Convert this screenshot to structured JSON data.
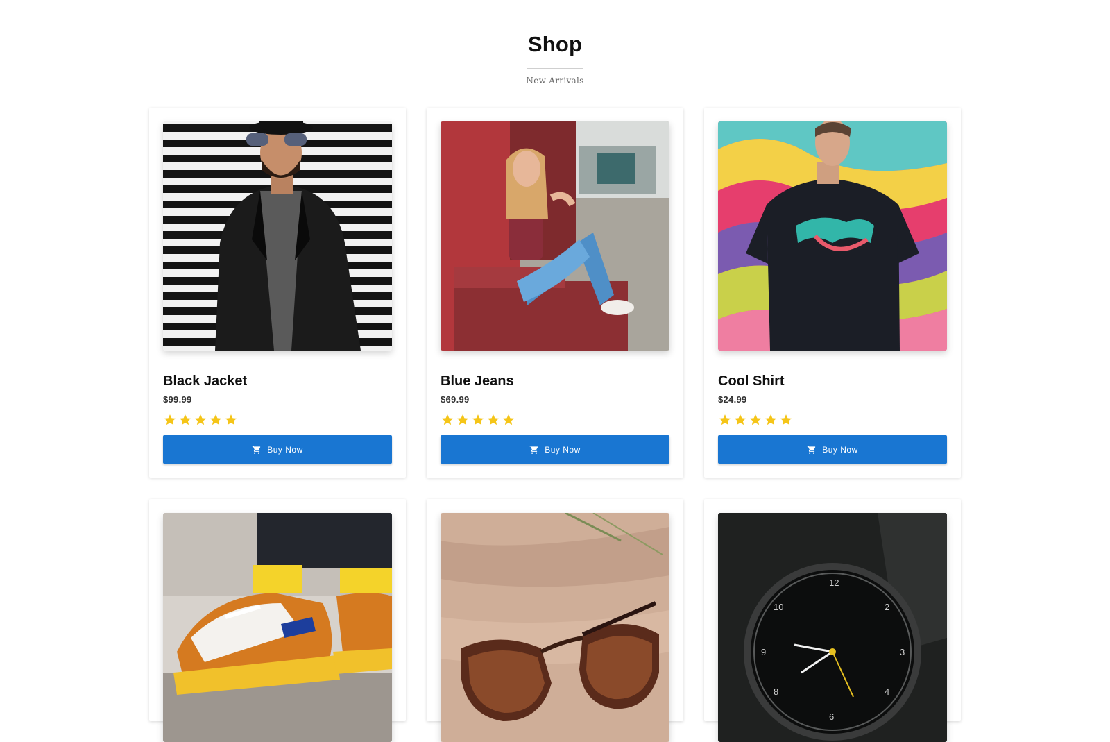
{
  "header": {
    "title": "Shop",
    "subtitle": "New Arrivals"
  },
  "colors": {
    "accent": "#1976d2",
    "star": "#f5c518"
  },
  "products": [
    {
      "name": "Black Jacket",
      "price": "$99.99",
      "rating": 5,
      "button_label": "Buy Now",
      "button_icon": "cart-icon",
      "image": "man-in-black-leather-jacket"
    },
    {
      "name": "Blue Jeans",
      "price": "$69.99",
      "rating": 5,
      "button_label": "Buy Now",
      "button_icon": "cart-icon",
      "image": "woman-in-blue-jeans-sitting"
    },
    {
      "name": "Cool Shirt",
      "price": "$24.99",
      "rating": 5,
      "button_label": "Buy Now",
      "button_icon": "cart-icon",
      "image": "man-in-graphic-tshirt"
    },
    {
      "image": "orange-sneakers"
    },
    {
      "image": "sunglasses-on-sand"
    },
    {
      "image": "black-wristwatch"
    }
  ]
}
